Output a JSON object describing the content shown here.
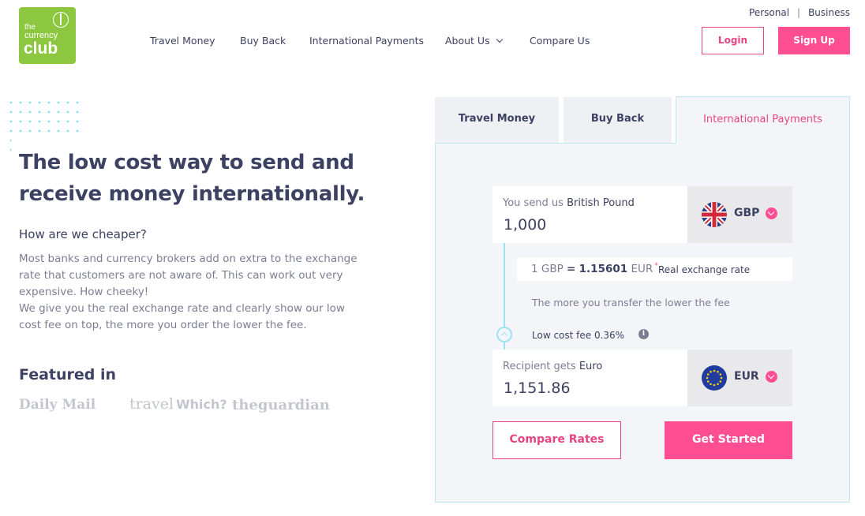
{
  "logo": {
    "line1": "the",
    "line2": "currency",
    "line3": "club"
  },
  "toplinks": {
    "personal": "Personal",
    "separator": "|",
    "business": "Business"
  },
  "nav": {
    "travel_money": "Travel Money",
    "buy_back": "Buy Back",
    "international_payments": "International Payments",
    "about_us": "About Us",
    "compare_us": "Compare Us"
  },
  "header_buttons": {
    "login": "Login",
    "signup": "Sign Up"
  },
  "hero": {
    "title_line1": "The low cost way to send and",
    "title_line2": "receive money internationally.",
    "subtitle": "How are we cheaper?",
    "body_p1": "Most banks and currency brokers add on extra to the exchange rate that customers are not aware of. This can work out very expensive. How cheeky!",
    "body_p2": "We give you the real exchange rate and clearly show our low cost fee on top, the more you order the lower the fee."
  },
  "featured": {
    "title": "Featured in",
    "logos": [
      "Daily Mail",
      "travel",
      "Which?",
      "theguardian"
    ]
  },
  "widget": {
    "tabs": [
      {
        "label": "Travel Money",
        "active": false
      },
      {
        "label": "Buy Back",
        "active": false
      },
      {
        "label": "International Payments",
        "active": true
      }
    ],
    "send": {
      "label_prefix": "You send us",
      "currency_name": "British Pound",
      "amount": "1,000",
      "currency_code": "GBP",
      "flag_icon": "uk-flag-icon"
    },
    "rate": {
      "base": "1 GBP",
      "equals": "=",
      "value": "1.15601",
      "quote": "EUR",
      "star": "*",
      "label": "Real exchange rate"
    },
    "more_text": "The more you transfer the lower the fee",
    "fee_text": "Low cost fee 0.36%",
    "info_icon_glyph": "i",
    "receive": {
      "label_prefix": "Recipient gets",
      "currency_name": "Euro",
      "amount": "1,151.86",
      "currency_code": "EUR",
      "flag_icon": "eu-flag-icon"
    },
    "buttons": {
      "compare": "Compare Rates",
      "start": "Get Started"
    }
  },
  "colors": {
    "brand_green": "#8dc63f",
    "accent_pink": "#ff4f92",
    "text_dark": "#3d4162",
    "panel_border": "#bfe8f1"
  }
}
